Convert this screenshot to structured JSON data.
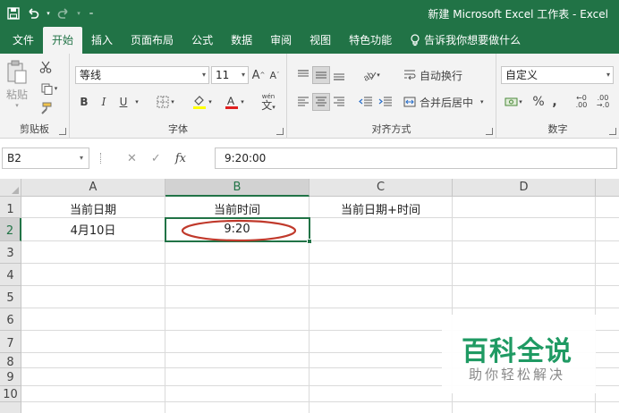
{
  "window": {
    "title": "新建 Microsoft Excel 工作表  -  Excel"
  },
  "ribbon_tabs": [
    "文件",
    "开始",
    "插入",
    "页面布局",
    "公式",
    "数据",
    "审阅",
    "视图",
    "特色功能",
    "告诉我你想要做什么"
  ],
  "active_tab": "开始",
  "clipboard": {
    "paste_label": "粘贴",
    "group_label": "剪贴板"
  },
  "font": {
    "name": "等线",
    "size": "11",
    "group_label": "字体",
    "phonetic_glyph": "wén"
  },
  "alignment": {
    "wrap_text": "自动换行",
    "merge_center": "合并后居中",
    "group_label": "对齐方式"
  },
  "number": {
    "format": "自定义",
    "group_label": "数字"
  },
  "formula_bar": {
    "name_box": "B2",
    "cancel": "✕",
    "enter": "✓",
    "fx": "fx",
    "value": "9:20:00"
  },
  "sheet": {
    "columns": [
      "A",
      "B",
      "C",
      "D"
    ],
    "rows": [
      "1",
      "2",
      "3",
      "4",
      "5",
      "6",
      "7",
      "8",
      "9",
      "10"
    ],
    "cells": {
      "A1": "当前日期",
      "B1": "当前时间",
      "C1": "当前日期+时间",
      "A2": "4月10日",
      "B2": "9:20"
    },
    "selected_cell": "B2"
  },
  "watermark": {
    "main": "百科全说",
    "sub": "助你轻松解决"
  },
  "colors": {
    "accent": "#217346",
    "highlight_ellipse": "#c0392b",
    "watermark_green": "#1f9a63"
  }
}
